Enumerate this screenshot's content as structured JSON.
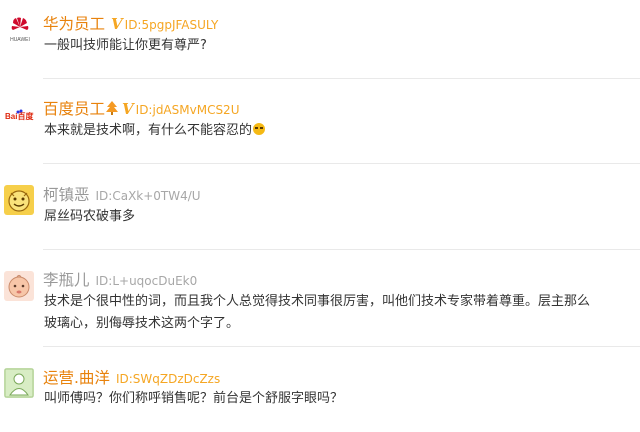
{
  "colors": {
    "orange_name": "#e8820c",
    "gray_name": "#999999",
    "id_orange": "#f5a623",
    "text": "#333333",
    "divider": "#e9e9e9"
  },
  "posts": [
    {
      "avatar_icon": "huawei-logo-icon",
      "avatar_text": "HUAWEI",
      "name": "华为员工",
      "badge": "V",
      "id_label": "ID:5pgpJFASULY",
      "content": "一般叫技师能让你更有尊严?"
    },
    {
      "avatar_icon": "baidu-logo-icon",
      "avatar_text": "Bai百度",
      "name": "百度员工",
      "badge": "V",
      "id_label": "ID:jdASMvMCS2U",
      "content": "本来就是技术啊，有什么不能容忍的"
    },
    {
      "avatar_icon": "smiley-face-avatar-icon",
      "name": "柯镇恶",
      "id_label": "ID:CaXk+0TW4/U",
      "content": "屌丝码农破事多"
    },
    {
      "avatar_icon": "baby-face-avatar-icon",
      "name": "李瓶儿",
      "id_label": "ID:L+uqocDuEk0",
      "content_line1": "技术是个很中性的词，而且我个人总觉得技术同事很厉害，叫他们技术专家带着尊重。层主那么",
      "content_line2": "玻璃心，别侮辱技术这两个字了。"
    },
    {
      "avatar_icon": "person-avatar-icon",
      "name": "运营.曲洋",
      "id_label": "ID:SWqZDzDcZzs",
      "content": "叫师傅吗？你们称呼销售呢？前台是个舒服字眼吗？"
    }
  ]
}
